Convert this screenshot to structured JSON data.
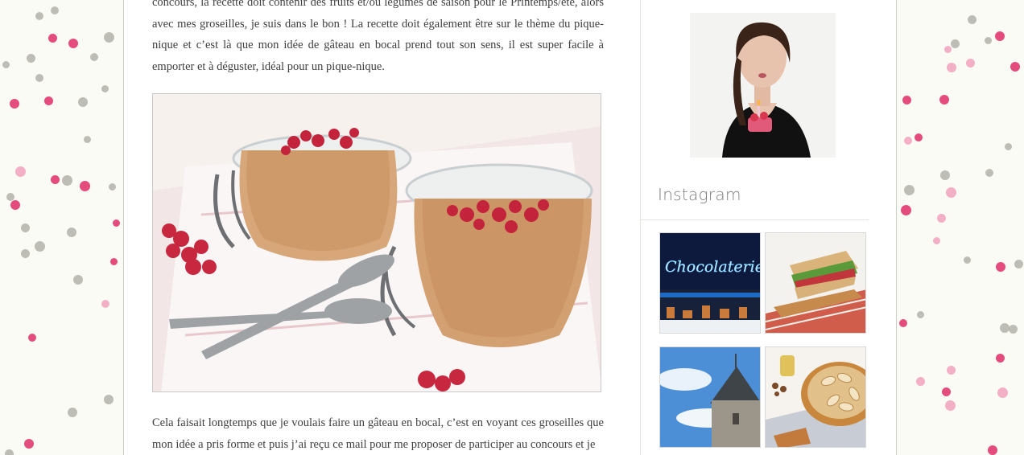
{
  "post": {
    "paragraph_1": "concours, la recette doit contenir des fruits et/ou légumes de saison pour le Printemps/été, alors avec mes groseilles, je suis dans le bon ! La recette doit également être sur le thème du pique-nique et c’est là que mon idée de gâteau en bocal prend tout son sens, il est super facile à emporter et à déguster, idéal pour un pique-nique.",
    "paragraph_2": "Cela faisait longtemps que je voulais faire un gâteau en bocal, c’est en voyant ces groseilles que mon idée a pris forme et puis j’ai reçu ce mail pour me proposer de participer au concours et je",
    "neon_sign_text": "Chocolaterie"
  },
  "sidebar": {
    "instagram_title": "Instagram"
  },
  "colors": {
    "dot_pink": "#e0396f",
    "dot_light_pink": "#f2a6c0",
    "dot_gray": "#a9a89f",
    "text": "#3e3e3e",
    "widget_title": "#7d7d7d"
  }
}
